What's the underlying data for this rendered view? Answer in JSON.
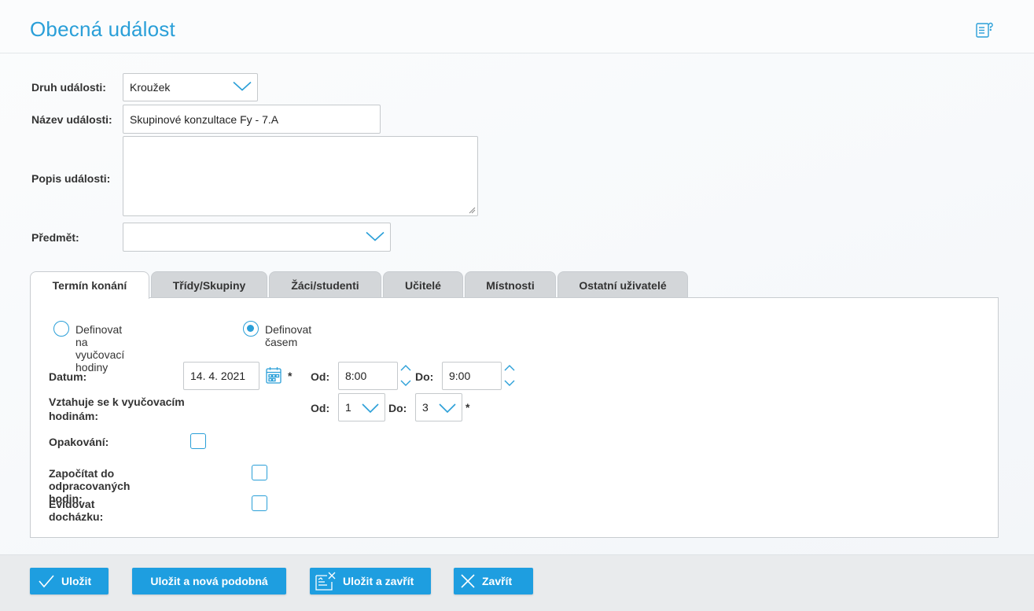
{
  "header": {
    "title": "Obecná událost",
    "help_icon": "help-document-icon"
  },
  "form": {
    "event_type_label": "Druh události:",
    "event_type_value": "Kroužek",
    "event_name_label": "Název události:",
    "event_name_value": "Skupinové konzultace Fy - 7.A",
    "event_desc_label": "Popis události:",
    "event_desc_value": "",
    "subject_label": "Předmět:",
    "subject_value": ""
  },
  "tabs": [
    {
      "label": "Termín konání",
      "active": true
    },
    {
      "label": "Třídy/Skupiny"
    },
    {
      "label": "Žáci/studenti"
    },
    {
      "label": "Učitelé"
    },
    {
      "label": "Místnosti"
    },
    {
      "label": "Ostatní uživatelé"
    }
  ],
  "panel": {
    "radio_lessons_label": "Definovat na vyučovací hodiny",
    "radio_time_label": "Definovat časem",
    "radio_selected": "time",
    "date_label": "Datum:",
    "date_value": "14. 4. 2021",
    "required_mark": "*",
    "from_label": "Od:",
    "from_time": "8:00",
    "to_label": "Do:",
    "to_time": "9:00",
    "lessons_label": "Vztahuje se k vyučovacím hodinám:",
    "lesson_from": "1",
    "lesson_to": "3",
    "repeat_label": "Opakování:",
    "worked_hours_label": "Započítat do odpracovaných hodin:",
    "attendance_label": "Evidovat docházku:",
    "repeat_checked": false,
    "worked_hours_checked": false,
    "attendance_checked": false
  },
  "footer": {
    "save": "Uložit",
    "save_new": "Uložit a nová podobná",
    "save_close": "Uložit a zavřít",
    "close": "Zavřít"
  },
  "colors": {
    "accent": "#2a9fd8",
    "button": "#1e9ee0"
  }
}
